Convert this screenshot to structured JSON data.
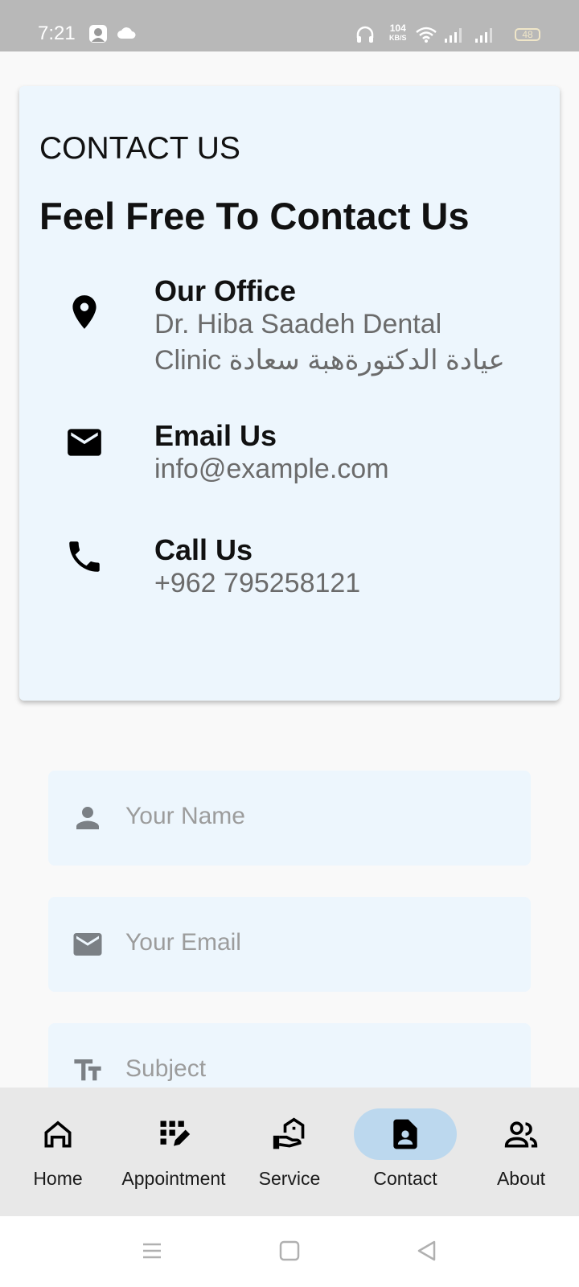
{
  "status_bar": {
    "time": "7:21",
    "speed_value": "104",
    "speed_unit": "KB/S",
    "battery": "48",
    "icons": [
      "avatar-icon",
      "cloud-icon",
      "headphones-icon",
      "wifi-icon",
      "signal-icon",
      "signal-icon"
    ]
  },
  "contact_card": {
    "eyebrow": "CONTACT US",
    "headline": "Feel Free To Contact Us",
    "items": [
      {
        "icon": "location-pin-icon",
        "title": "Our Office",
        "value": "Dr. Hiba Saadeh Dental Clinic عيادة الدكتورةهبة سعادة"
      },
      {
        "icon": "email-icon",
        "title": "Email Us",
        "value": "info@example.com"
      },
      {
        "icon": "phone-icon",
        "title": "Call Us",
        "value": "+962 795258121"
      }
    ]
  },
  "form": {
    "name_placeholder": "Your Name",
    "email_placeholder": "Your Email",
    "subject_placeholder": "Subject"
  },
  "bottom_nav": {
    "active": "Contact",
    "items": [
      {
        "label": "Home",
        "icon": "home-icon"
      },
      {
        "label": "Appointment",
        "icon": "appointment-icon"
      },
      {
        "label": "Service",
        "icon": "service-icon"
      },
      {
        "label": "Contact",
        "icon": "contact-icon"
      },
      {
        "label": "About",
        "icon": "about-icon"
      }
    ]
  },
  "colors": {
    "card_bg": "#edf6fd",
    "active_pill": "#bcd8ee",
    "nav_bg": "#e8e8e8",
    "status_bar": "#b8b8b8"
  }
}
